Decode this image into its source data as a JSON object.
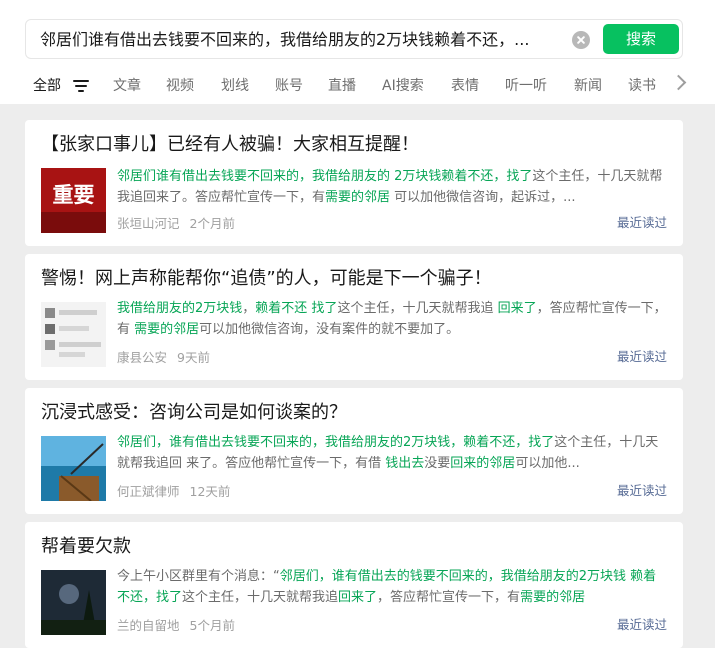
{
  "search": {
    "query": "邻居们谁有借出去钱要不回来的，我借给朋友的2万块钱赖着不还，...",
    "button_label": "搜索"
  },
  "tabs": [
    "全部",
    "文章",
    "视频",
    "划线",
    "账号",
    "直播",
    "AI搜索",
    "表情",
    "听一听",
    "新闻",
    "读书"
  ],
  "results": [
    {
      "title": "【张家口事儿】已经有人被骗！大家相互提醒！",
      "thumb_text": "重要",
      "snippet": [
        {
          "t": "邻居们谁有借出去钱要不回来的，我借给朋友的 2万块钱赖着不还，找了",
          "h": true
        },
        {
          "t": "这个主任，十几天就帮 我追回来了。答应帮忙宣传一下，有",
          "h": false
        },
        {
          "t": "需要的邻居",
          "h": true
        },
        {
          "t": " 可以加他微信咨询，起诉过，...",
          "h": false
        }
      ],
      "source": "张垣山河记",
      "time": "2个月前",
      "recent": "最近读过"
    },
    {
      "title": "警惕！网上声称能帮你“追债”的人，可能是下一个骗子！",
      "snippet": [
        {
          "t": "我借给朋友的2万块钱",
          "h": true
        },
        {
          "t": "，",
          "h": false
        },
        {
          "t": "赖着不还 找了",
          "h": true
        },
        {
          "t": "这个主任，十几天就帮我追 ",
          "h": false
        },
        {
          "t": "回来了",
          "h": true
        },
        {
          "t": "，答应帮忙宣传一下，有 ",
          "h": false
        },
        {
          "t": "需要的邻居",
          "h": true
        },
        {
          "t": "可以加他微信咨询，没有案件的就不要加了。",
          "h": false
        }
      ],
      "source": "康县公安",
      "time": "9天前",
      "recent": "最近读过"
    },
    {
      "title": "沉浸式感受：咨询公司是如何谈案的？",
      "snippet": [
        {
          "t": "邻居们，谁有借出去钱要不回来的，我借给朋友的2万块钱，赖着不还，找了",
          "h": true
        },
        {
          "t": "这个主任，十几天就帮我追回 来了。答应他帮忙宣传一下，有借 ",
          "h": false
        },
        {
          "t": "钱出去",
          "h": true
        },
        {
          "t": "没要",
          "h": false
        },
        {
          "t": "回来的邻居",
          "h": true
        },
        {
          "t": "可以加他...",
          "h": false
        }
      ],
      "source": "何正斌律师",
      "time": "12天前",
      "recent": "最近读过"
    },
    {
      "title": "帮着要欠款",
      "snippet": [
        {
          "t": "今上午小区群里有个消息：“",
          "h": false
        },
        {
          "t": "邻居们，谁有借出去的钱要不回来的，我借给朋友的2万块钱 赖着不还，找了",
          "h": true
        },
        {
          "t": "这个主任，十几天就帮我追",
          "h": false
        },
        {
          "t": "回来了",
          "h": true
        },
        {
          "t": "，答应帮忙宣传一下，有",
          "h": false
        },
        {
          "t": "需要的邻居",
          "h": true
        }
      ],
      "source": "兰的自留地",
      "time": "5个月前",
      "recent": "最近读过"
    }
  ],
  "colors": {
    "accent": "#07c160",
    "highlight": "#07a556",
    "link": "#576b95"
  }
}
